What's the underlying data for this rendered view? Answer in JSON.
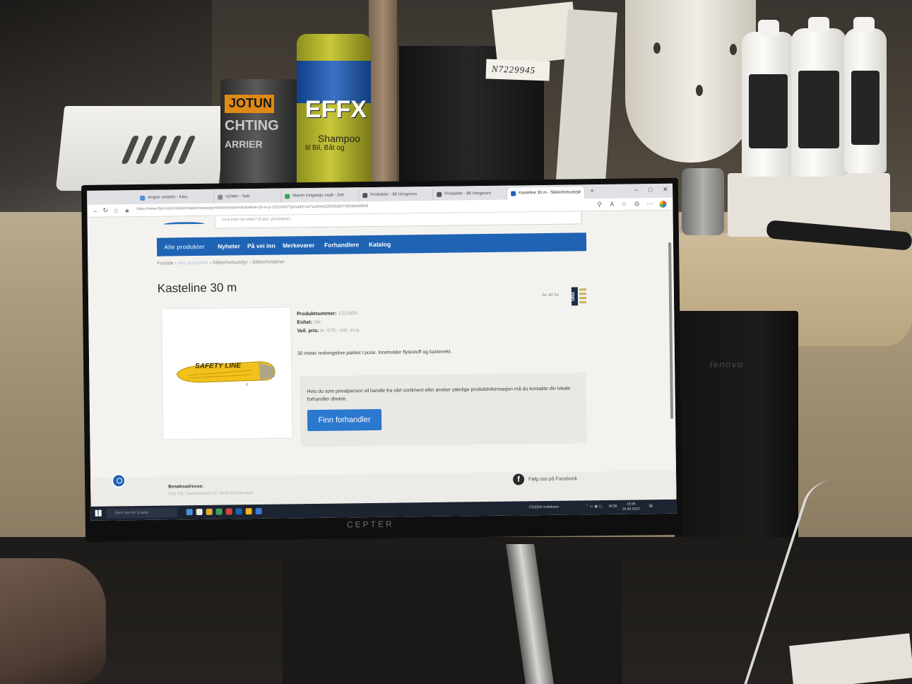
{
  "scene": {
    "jotun_label": "JOTUN",
    "jotun_line2": "CHTING",
    "jotun_line3": "ARRIER",
    "effx_label": "EFFX",
    "effx_sub": "Shampoo",
    "effx_sub2": "til Bil, Båt og",
    "tag_code": "N7229945",
    "pc_brand": "lenovo",
    "monitor_brand": "CEPTER"
  },
  "browser": {
    "tabs": [
      {
        "label": "Angrer avtalen - Kleu",
        "color": "#4a8fd8"
      },
      {
        "label": "nyhder - Salt",
        "color": "#8a8a8a"
      },
      {
        "label": "Maren Inngangs saalt - Det",
        "color": "#3aa55a"
      },
      {
        "label": "Produkter - 86 Hergesen",
        "color": "#555555"
      },
      {
        "label": "Produkter - 86 Hergesen",
        "color": "#555555"
      },
      {
        "label": "Kasteline 30 m - Sikkerhetsutstyr",
        "color": "#1f63b4"
      }
    ],
    "new_tab": "+",
    "url": "https://www.flytr.no/produkter/sikkerhetsutstyr/sikkerhetsliner/kasteline-30-m-p-1021600/?groupId=a47a1f64a52f65f5dbf7365d6e06858",
    "window_controls": [
      "–",
      "□",
      "✕"
    ]
  },
  "page": {
    "search_placeholder": "Hva leter du etter? (f.eks. produkter)",
    "nav": [
      "Alle produkter",
      "Nyheter",
      "På vei inn",
      "Merkevarer",
      "Forhandlere",
      "Katalog"
    ],
    "breadcrumb": {
      "home": "Forside",
      "sep": " › ",
      "level1": "Alle produkter",
      "level2": "Sikkerhetsutstyr",
      "level3": "Sikkerhetsliner"
    },
    "title": "Kasteline 30 m",
    "see_all": "Se alt fra",
    "brand_badge": "1852",
    "product_image_text": "SAFETY LINE",
    "product_number_label": "Produktnummer:",
    "product_number": "1021600",
    "unit_label": "Enhet:",
    "unit": "Stk",
    "price_label": "Veil. pris:",
    "price": "kr. 679,- inkl. mva.",
    "description": "30 meter redningsline pakket i pose. Inneholder flytestoff og kastevekt.",
    "cta_text": "Hvis du som privatperson vil handle fra vårt sortiment eller ønsker ytterlige produktinformasjon må du kontakte din lokale forhandler direkte.",
    "cta_button": "Finn forhandler",
    "footer_label": "Besøksadresse:",
    "footer_address": "Flytr AS, Sandvolveien 37, 4630 Kristiansand",
    "facebook_text": "Følg oss på Facebook",
    "facebook_icon_letter": "f"
  },
  "taskbar": {
    "search_placeholder": "Skriv her for å søke",
    "weather": "OSEBX-indeksen",
    "lang": "NOB",
    "time": "15:08",
    "date": "16.06.2023",
    "icon_colors": [
      "#4a8fd8",
      "#e8e8e8",
      "#e8a92b",
      "#3aa55a",
      "#d64535",
      "#1f63b4",
      "#f2b41c",
      "#3c78d8"
    ]
  }
}
